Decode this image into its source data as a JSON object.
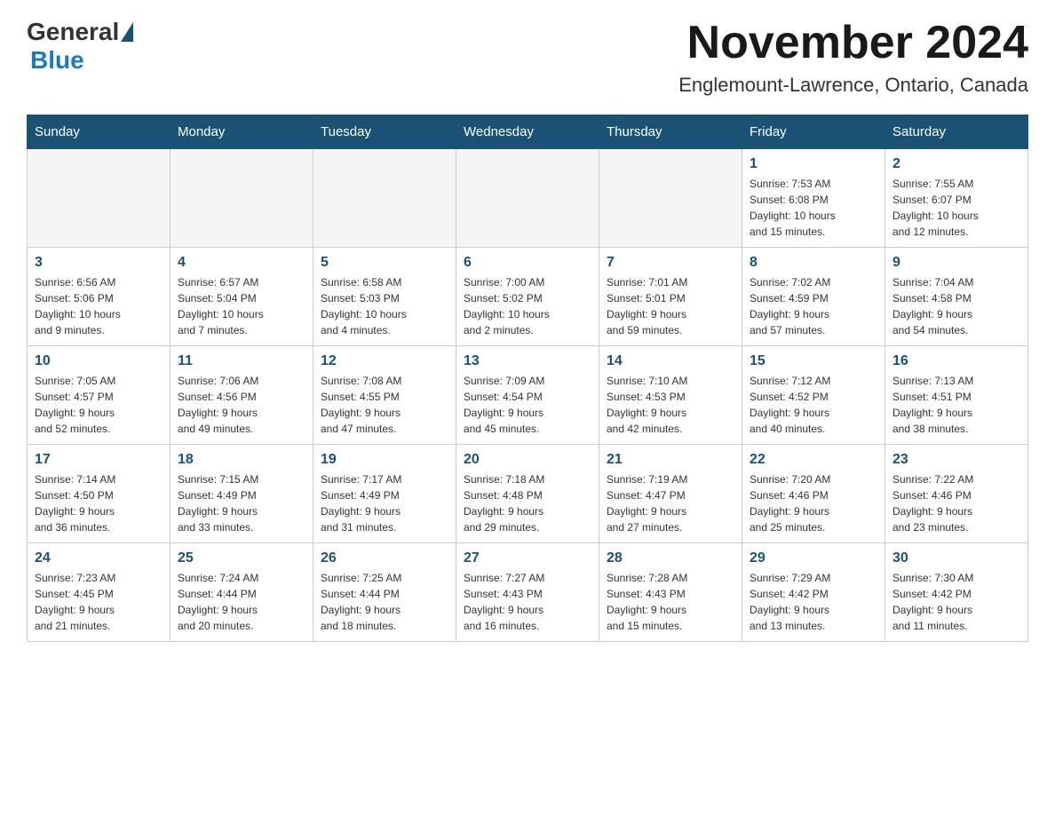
{
  "logo": {
    "general": "General",
    "blue": "Blue"
  },
  "title": {
    "month": "November 2024",
    "location": "Englemount-Lawrence, Ontario, Canada"
  },
  "weekdays": [
    "Sunday",
    "Monday",
    "Tuesday",
    "Wednesday",
    "Thursday",
    "Friday",
    "Saturday"
  ],
  "weeks": [
    [
      {
        "day": "",
        "info": ""
      },
      {
        "day": "",
        "info": ""
      },
      {
        "day": "",
        "info": ""
      },
      {
        "day": "",
        "info": ""
      },
      {
        "day": "",
        "info": ""
      },
      {
        "day": "1",
        "info": "Sunrise: 7:53 AM\nSunset: 6:08 PM\nDaylight: 10 hours\nand 15 minutes."
      },
      {
        "day": "2",
        "info": "Sunrise: 7:55 AM\nSunset: 6:07 PM\nDaylight: 10 hours\nand 12 minutes."
      }
    ],
    [
      {
        "day": "3",
        "info": "Sunrise: 6:56 AM\nSunset: 5:06 PM\nDaylight: 10 hours\nand 9 minutes."
      },
      {
        "day": "4",
        "info": "Sunrise: 6:57 AM\nSunset: 5:04 PM\nDaylight: 10 hours\nand 7 minutes."
      },
      {
        "day": "5",
        "info": "Sunrise: 6:58 AM\nSunset: 5:03 PM\nDaylight: 10 hours\nand 4 minutes."
      },
      {
        "day": "6",
        "info": "Sunrise: 7:00 AM\nSunset: 5:02 PM\nDaylight: 10 hours\nand 2 minutes."
      },
      {
        "day": "7",
        "info": "Sunrise: 7:01 AM\nSunset: 5:01 PM\nDaylight: 9 hours\nand 59 minutes."
      },
      {
        "day": "8",
        "info": "Sunrise: 7:02 AM\nSunset: 4:59 PM\nDaylight: 9 hours\nand 57 minutes."
      },
      {
        "day": "9",
        "info": "Sunrise: 7:04 AM\nSunset: 4:58 PM\nDaylight: 9 hours\nand 54 minutes."
      }
    ],
    [
      {
        "day": "10",
        "info": "Sunrise: 7:05 AM\nSunset: 4:57 PM\nDaylight: 9 hours\nand 52 minutes."
      },
      {
        "day": "11",
        "info": "Sunrise: 7:06 AM\nSunset: 4:56 PM\nDaylight: 9 hours\nand 49 minutes."
      },
      {
        "day": "12",
        "info": "Sunrise: 7:08 AM\nSunset: 4:55 PM\nDaylight: 9 hours\nand 47 minutes."
      },
      {
        "day": "13",
        "info": "Sunrise: 7:09 AM\nSunset: 4:54 PM\nDaylight: 9 hours\nand 45 minutes."
      },
      {
        "day": "14",
        "info": "Sunrise: 7:10 AM\nSunset: 4:53 PM\nDaylight: 9 hours\nand 42 minutes."
      },
      {
        "day": "15",
        "info": "Sunrise: 7:12 AM\nSunset: 4:52 PM\nDaylight: 9 hours\nand 40 minutes."
      },
      {
        "day": "16",
        "info": "Sunrise: 7:13 AM\nSunset: 4:51 PM\nDaylight: 9 hours\nand 38 minutes."
      }
    ],
    [
      {
        "day": "17",
        "info": "Sunrise: 7:14 AM\nSunset: 4:50 PM\nDaylight: 9 hours\nand 36 minutes."
      },
      {
        "day": "18",
        "info": "Sunrise: 7:15 AM\nSunset: 4:49 PM\nDaylight: 9 hours\nand 33 minutes."
      },
      {
        "day": "19",
        "info": "Sunrise: 7:17 AM\nSunset: 4:49 PM\nDaylight: 9 hours\nand 31 minutes."
      },
      {
        "day": "20",
        "info": "Sunrise: 7:18 AM\nSunset: 4:48 PM\nDaylight: 9 hours\nand 29 minutes."
      },
      {
        "day": "21",
        "info": "Sunrise: 7:19 AM\nSunset: 4:47 PM\nDaylight: 9 hours\nand 27 minutes."
      },
      {
        "day": "22",
        "info": "Sunrise: 7:20 AM\nSunset: 4:46 PM\nDaylight: 9 hours\nand 25 minutes."
      },
      {
        "day": "23",
        "info": "Sunrise: 7:22 AM\nSunset: 4:46 PM\nDaylight: 9 hours\nand 23 minutes."
      }
    ],
    [
      {
        "day": "24",
        "info": "Sunrise: 7:23 AM\nSunset: 4:45 PM\nDaylight: 9 hours\nand 21 minutes."
      },
      {
        "day": "25",
        "info": "Sunrise: 7:24 AM\nSunset: 4:44 PM\nDaylight: 9 hours\nand 20 minutes."
      },
      {
        "day": "26",
        "info": "Sunrise: 7:25 AM\nSunset: 4:44 PM\nDaylight: 9 hours\nand 18 minutes."
      },
      {
        "day": "27",
        "info": "Sunrise: 7:27 AM\nSunset: 4:43 PM\nDaylight: 9 hours\nand 16 minutes."
      },
      {
        "day": "28",
        "info": "Sunrise: 7:28 AM\nSunset: 4:43 PM\nDaylight: 9 hours\nand 15 minutes."
      },
      {
        "day": "29",
        "info": "Sunrise: 7:29 AM\nSunset: 4:42 PM\nDaylight: 9 hours\nand 13 minutes."
      },
      {
        "day": "30",
        "info": "Sunrise: 7:30 AM\nSunset: 4:42 PM\nDaylight: 9 hours\nand 11 minutes."
      }
    ]
  ]
}
